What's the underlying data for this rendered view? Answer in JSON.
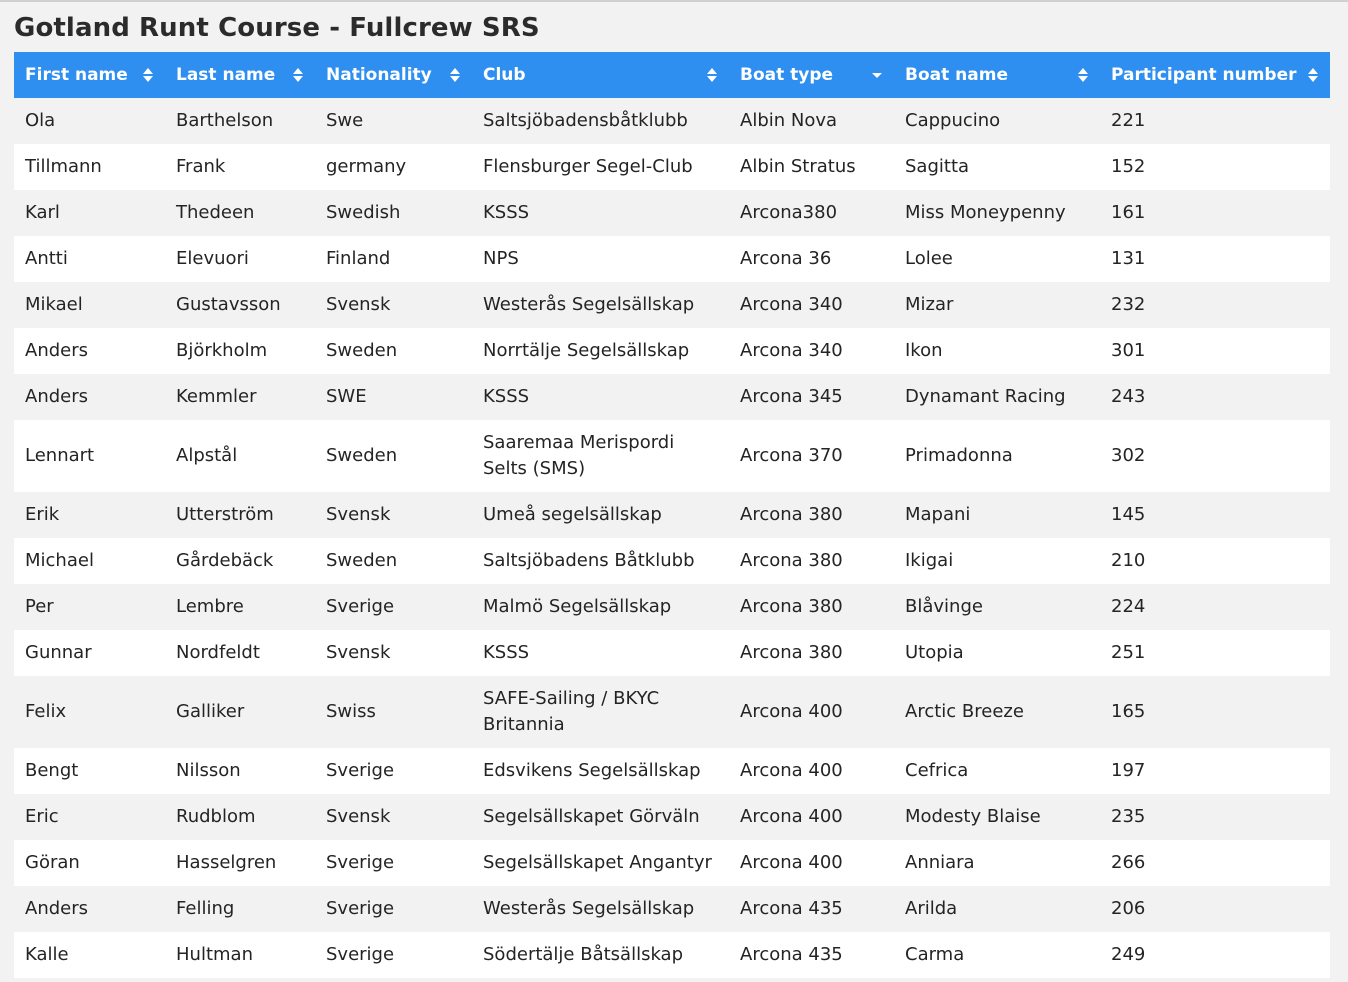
{
  "page": {
    "title": "Gotland Runt Course - Fullcrew SRS"
  },
  "colors": {
    "header_bg": "#2f8ff0",
    "row_odd": "#f2f2f2",
    "row_even": "#ffffff"
  },
  "table": {
    "columns": [
      {
        "label": "First name",
        "sort": "both"
      },
      {
        "label": "Last name",
        "sort": "both"
      },
      {
        "label": "Nationality",
        "sort": "both"
      },
      {
        "label": "Club",
        "sort": "both"
      },
      {
        "label": "Boat type",
        "sort": "desc"
      },
      {
        "label": "Boat name",
        "sort": "both"
      },
      {
        "label": "Participant number",
        "sort": "both"
      }
    ],
    "rows": [
      [
        "Ola",
        "Barthelson",
        "Swe",
        "Saltsjöbadensbåtklubb",
        "Albin Nova",
        "Cappucino",
        "221"
      ],
      [
        "Tillmann",
        "Frank",
        "germany",
        "Flensburger Segel-Club",
        "Albin Stratus",
        "Sagitta",
        "152"
      ],
      [
        "Karl",
        "Thedeen",
        "Swedish",
        "KSSS",
        "Arcona380",
        "Miss Moneypenny",
        "161"
      ],
      [
        "Antti",
        "Elevuori",
        "Finland",
        "NPS",
        "Arcona 36",
        "Lolee",
        "131"
      ],
      [
        "Mikael",
        "Gustavsson",
        "Svensk",
        "Westerås Segelsällskap",
        "Arcona 340",
        "Mizar",
        "232"
      ],
      [
        "Anders",
        "Björkholm",
        "Sweden",
        "Norrtälje Segelsällskap",
        "Arcona 340",
        "Ikon",
        "301"
      ],
      [
        "Anders",
        "Kemmler",
        "SWE",
        "KSSS",
        "Arcona 345",
        "Dynamant Racing",
        "243"
      ],
      [
        "Lennart",
        "Alpstål",
        "Sweden",
        "Saaremaa Merispordi Selts (SMS)",
        "Arcona 370",
        "Primadonna",
        "302"
      ],
      [
        "Erik",
        "Utterström",
        "Svensk",
        "Umeå segelsällskap",
        "Arcona 380",
        "Mapani",
        "145"
      ],
      [
        "Michael",
        "Gårdebäck",
        "Sweden",
        "Saltsjöbadens Båtklubb",
        "Arcona 380",
        "Ikigai",
        "210"
      ],
      [
        "Per",
        "Lembre",
        "Sverige",
        "Malmö Segelsällskap",
        "Arcona 380",
        "Blåvinge",
        "224"
      ],
      [
        "Gunnar",
        "Nordfeldt",
        "Svensk",
        "KSSS",
        "Arcona 380",
        "Utopia",
        "251"
      ],
      [
        "Felix",
        "Galliker",
        "Swiss",
        "SAFE-Sailing / BKYC Britannia",
        "Arcona 400",
        "Arctic Breeze",
        "165"
      ],
      [
        "Bengt",
        "Nilsson",
        "Sverige",
        "Edsvikens Segelsällskap",
        "Arcona 400",
        "Cefrica",
        "197"
      ],
      [
        "Eric",
        "Rudblom",
        "Svensk",
        "Segelsällskapet Görväln",
        "Arcona 400",
        "Modesty Blaise",
        "235"
      ],
      [
        "Göran",
        "Hasselgren",
        "Sverige",
        "Segelsällskapet Angantyr",
        "Arcona 400",
        "Anniara",
        "266"
      ],
      [
        "Anders",
        "Felling",
        "Sverige",
        "Westerås Segelsällskap",
        "Arcona 435",
        "Arilda",
        "206"
      ],
      [
        "Kalle",
        "Hultman",
        "Sverige",
        "Södertälje Båtsällskap",
        "Arcona 435",
        "Carma",
        "249"
      ]
    ]
  }
}
